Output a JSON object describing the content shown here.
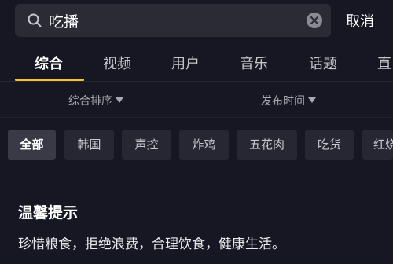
{
  "search": {
    "query": "吃播",
    "icon": "search-icon",
    "clear_icon": "clear-icon",
    "cancel_label": "取消"
  },
  "tabs": [
    {
      "label": "综合",
      "active": true
    },
    {
      "label": "视频",
      "active": false
    },
    {
      "label": "用户",
      "active": false
    },
    {
      "label": "音乐",
      "active": false
    },
    {
      "label": "话题",
      "active": false
    },
    {
      "label": "直",
      "active": false
    }
  ],
  "filters": {
    "sort_label": "综合排序",
    "time_label": "发布时间"
  },
  "chips": [
    {
      "label": "全部",
      "active": true
    },
    {
      "label": "韩国",
      "active": false
    },
    {
      "label": "声控",
      "active": false
    },
    {
      "label": "炸鸡",
      "active": false
    },
    {
      "label": "五花肉",
      "active": false
    },
    {
      "label": "吃货",
      "active": false
    },
    {
      "label": "红烧",
      "active": false
    }
  ],
  "tip": {
    "title": "温馨提示",
    "text": "珍惜粮食，拒绝浪费，合理饮食，健康生活。"
  },
  "colors": {
    "background": "#161722",
    "accent": "#f3c623",
    "search_bg": "#2a2b35",
    "chip_bg": "#262732"
  }
}
